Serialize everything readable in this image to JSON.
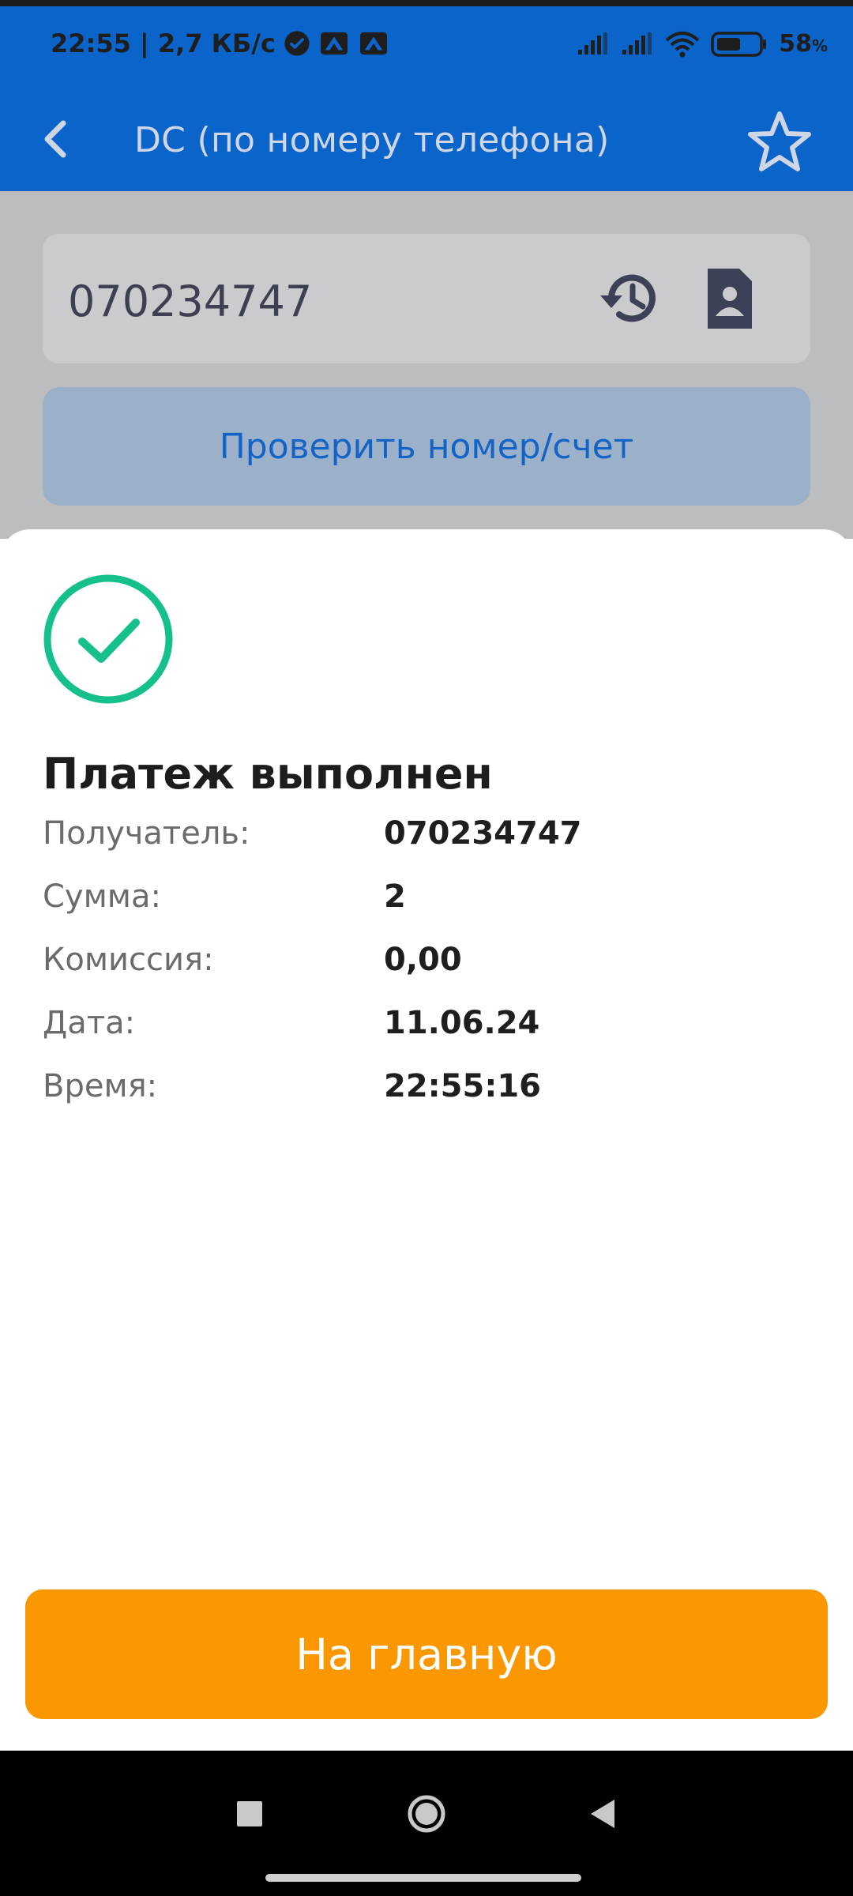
{
  "status_bar": {
    "time_speed": "22:55 | 2,7 КБ/с",
    "battery": "58",
    "battery_unit": "%",
    "battery_level_percent": 58
  },
  "app_bar": {
    "title": "DC (по номеру телефона)"
  },
  "form": {
    "phone_value": "070234747",
    "check_button_label": "Проверить номер/счет"
  },
  "sheet": {
    "title": "Платеж выполнен",
    "details": [
      {
        "label": "Получатель:",
        "value": "070234747"
      },
      {
        "label": "Сумма:",
        "value": "2"
      },
      {
        "label": "Комиссия:",
        "value": "0,00"
      },
      {
        "label": "Дата:",
        "value": "11.06.24"
      },
      {
        "label": "Время:",
        "value": "22:55:16"
      }
    ],
    "home_button_label": "На главную"
  },
  "colors": {
    "primary_blue": "#0b64c9",
    "success_green": "#16c08c",
    "accent_orange": "#fb9700"
  }
}
